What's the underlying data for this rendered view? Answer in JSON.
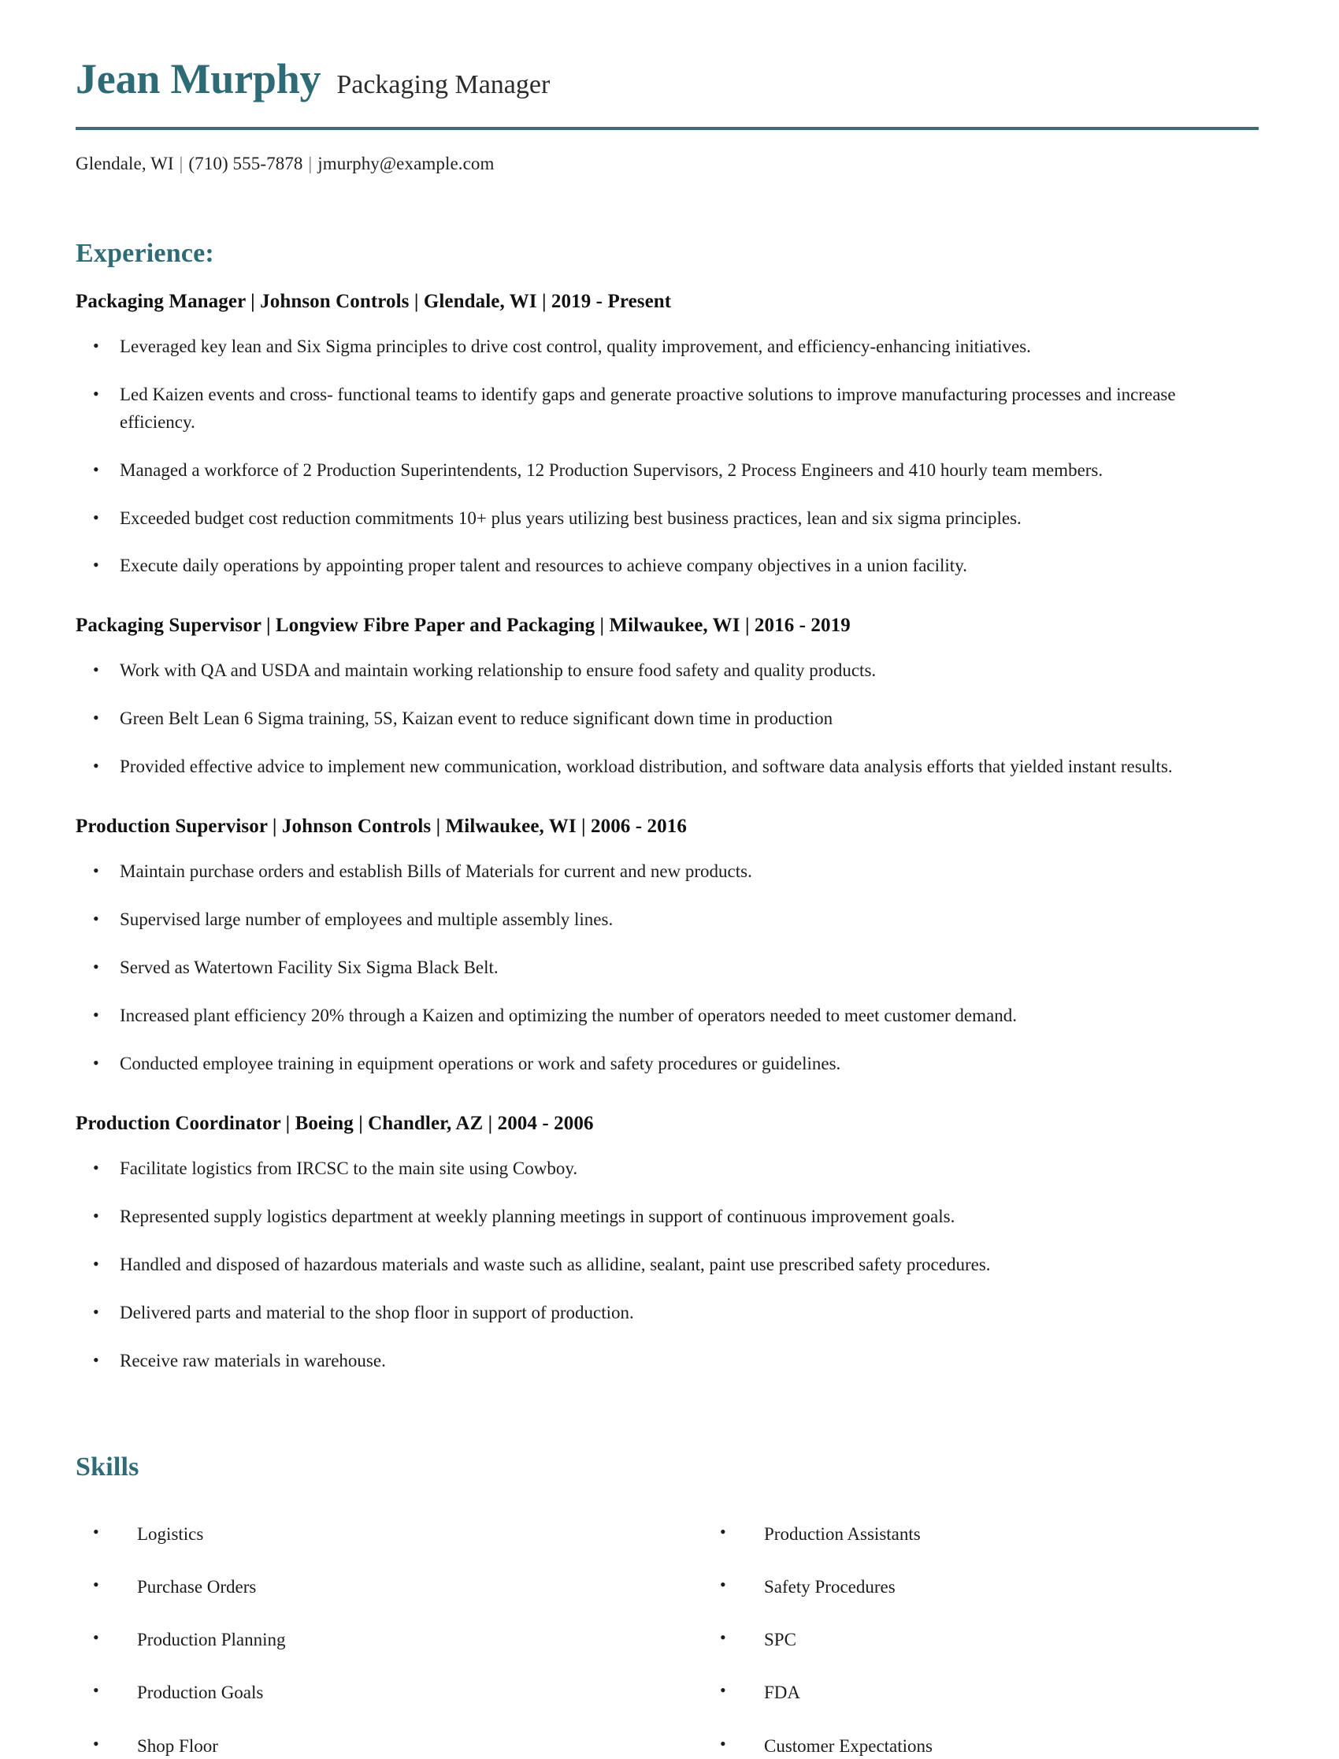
{
  "theme": {
    "accent": "#2f6b76",
    "rule": "#3c6d77",
    "text": "#1c1c1c",
    "heading_text": "#121212",
    "background": "#ffffff"
  },
  "header": {
    "full_name": "Jean Murphy",
    "job_title": "Packaging Manager",
    "contact": {
      "location": "Glendale, WI",
      "phone": "(710) 555-7878",
      "email": "jmurphy@example.com",
      "separator": "|"
    }
  },
  "experience": {
    "title": "Experience:",
    "jobs": [
      {
        "heading": "Packaging Manager | Johnson Controls | Glendale, WI | 2019 - Present",
        "bullets": [
          "Leveraged key lean and Six Sigma principles to drive cost control, quality improvement, and efficiency-enhancing initiatives.",
          "Led Kaizen events and cross- functional teams to identify gaps and generate proactive solutions to improve manufacturing processes and increase efficiency.",
          "Managed a workforce of 2 Production Superintendents, 12 Production Supervisors, 2 Process Engineers and 410 hourly team members.",
          "Exceeded budget cost reduction commitments 10+ plus years utilizing best business practices, lean and six sigma principles.",
          "Execute daily operations by appointing proper talent and resources to achieve company objectives in a union facility."
        ]
      },
      {
        "heading": "Packaging Supervisor | Longview Fibre Paper and Packaging | Milwaukee, WI | 2016 - 2019",
        "bullets": [
          "Work with QA and USDA and maintain working relationship to ensure food safety and quality products.",
          "Green Belt Lean 6 Sigma training, 5S, Kaizan event to reduce significant down time in production",
          "Provided effective advice to implement new communication, workload distribution, and software data analysis efforts that yielded instant results."
        ]
      },
      {
        "heading": "Production Supervisor | Johnson Controls | Milwaukee, WI | 2006 - 2016",
        "bullets": [
          "Maintain purchase orders and establish Bills of Materials for current and new products.",
          "Supervised large number of employees and multiple assembly lines.",
          "Served as Watertown Facility Six Sigma Black Belt.",
          "Increased plant efficiency 20% through a Kaizen and optimizing the number of operators needed to meet customer demand.",
          "Conducted employee training in equipment operations or work and safety procedures or guidelines."
        ]
      },
      {
        "heading": "Production Coordinator | Boeing | Chandler, AZ | 2004 - 2006",
        "bullets": [
          "Facilitate logistics from IRCSC to the main site using Cowboy.",
          "Represented supply logistics department at weekly planning meetings in support of continuous improvement goals.",
          "Handled and disposed of hazardous materials and waste such as allidine, sealant, paint use prescribed safety procedures.",
          "Delivered parts and material to the shop floor in support of production.",
          "Receive raw materials in warehouse."
        ]
      }
    ]
  },
  "skills": {
    "title": "Skills",
    "left_column": [
      "Logistics",
      "Purchase Orders",
      "Production Planning",
      "Production Goals",
      "Shop Floor"
    ],
    "right_column": [
      "Production Assistants",
      "Safety Procedures",
      "SPC",
      "FDA",
      "Customer Expectations"
    ]
  }
}
